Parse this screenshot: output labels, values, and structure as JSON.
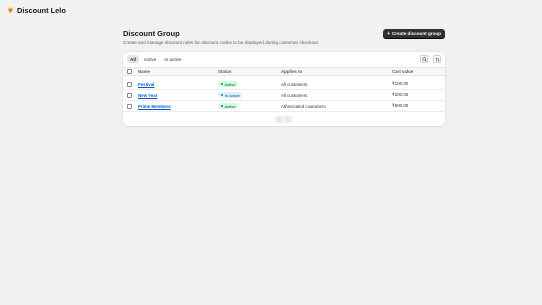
{
  "app": {
    "name": "Discount Lelo",
    "logo_icon": "logo-icon",
    "accent": "#e8841c"
  },
  "header": {
    "title": "Discount Group",
    "subtitle": "Create and manage discount rules for discount codes to be displayed during customer checkout.",
    "create_button": "Create discount group",
    "create_icon": "+"
  },
  "tabs": [
    {
      "label": "All",
      "selected": true
    },
    {
      "label": "Active",
      "selected": false
    },
    {
      "label": "In active",
      "selected": false
    }
  ],
  "toolbar": {
    "search_icon": "search-icon",
    "sort_icon": "sort-icon"
  },
  "table": {
    "columns": {
      "name": "Name",
      "status": "Status",
      "applies_to": "Applies to",
      "cart_value": "Cart value"
    },
    "rows": [
      {
        "name": "Festival",
        "status": "Active",
        "status_type": "active",
        "applies_to": "All customers",
        "cart_value": "₹100.00"
      },
      {
        "name": "New Year",
        "status": "In Active",
        "status_type": "inactive",
        "applies_to": "All customers",
        "cart_value": "₹200.00"
      },
      {
        "name": "Prime Members",
        "status": "Active",
        "status_type": "active",
        "applies_to": "Athenicated customers",
        "cart_value": "₹500.00"
      }
    ]
  },
  "pagination": {
    "prev": "‹",
    "next": "›"
  },
  "colors": {
    "active_bg": "#cdfee1",
    "inactive_bg": "#e0f0ff",
    "link": "#005bd3",
    "button": "#303030"
  }
}
